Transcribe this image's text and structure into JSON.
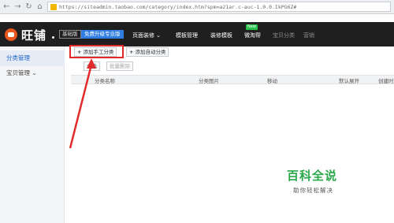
{
  "browser": {
    "url": "https://siteadmin.taobao.com/category/index.htm?spm=a21ar.c-auc-1.0.0.IkPG6Z#"
  },
  "topnav": {
    "logo_text": "旺铺",
    "edition_badge": "基础版",
    "upgrade_badge": "免费升级专业版",
    "menu": [
      {
        "label": "页面装修",
        "has_chevron": true
      },
      {
        "label": "模板管理"
      },
      {
        "label": "装修模板"
      },
      {
        "label": "微淘帮",
        "tag": "New"
      },
      {
        "label": "宝贝分类"
      },
      {
        "label": "营销"
      }
    ]
  },
  "sidebar": {
    "items": [
      {
        "label": "分类管理",
        "active": true
      },
      {
        "label": "宝贝管理",
        "has_chevron": true
      }
    ]
  },
  "toolbar": {
    "add_manual_label": "添加手工分类",
    "add_auto_label": "添加自动分类",
    "expand_label": "全选",
    "batch_delete_label": "批量删除"
  },
  "table": {
    "columns": [
      "分类名称",
      "分类图片",
      "移动",
      "默认展开",
      "创建时间"
    ]
  },
  "watermark": {
    "title": "百科全说",
    "subtitle": "助你轻松解决"
  },
  "colors": {
    "highlight": "#e32a2a",
    "accent": "#2f7de1",
    "nav_bg": "#1f1f1f",
    "watermark": "#2aa84a"
  }
}
